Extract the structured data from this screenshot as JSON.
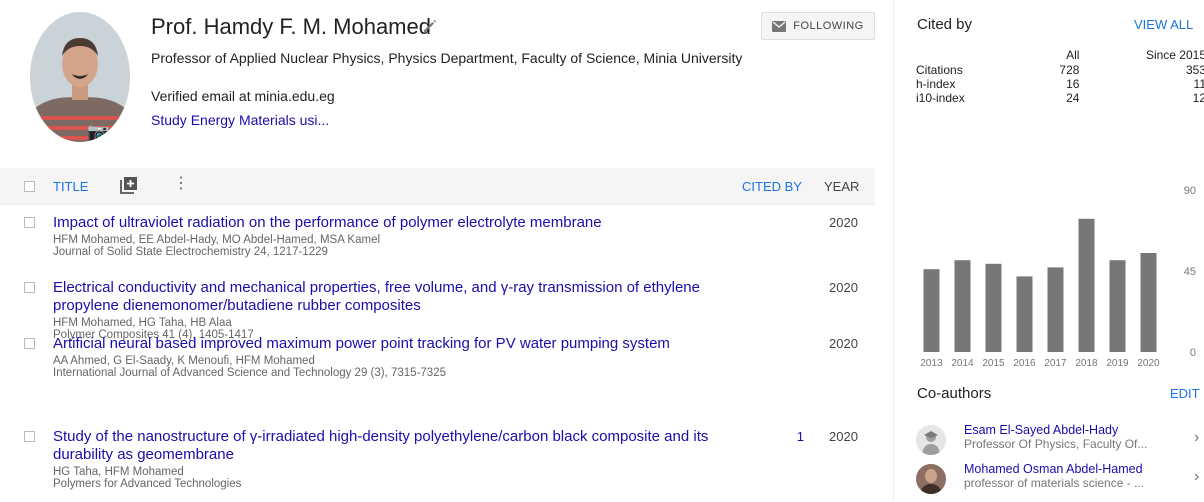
{
  "profile": {
    "name": "Prof. Hamdy F. M. Mohamed",
    "affiliation": "Professor of Applied Nuclear Physics, Physics Department, Faculty of Science, Minia University",
    "email": "Verified email at minia.edu.eg",
    "interest": "Study Energy Materials usi...",
    "follow_label": "FOLLOWING"
  },
  "table": {
    "title_header": "TITLE",
    "cited_by_header": "CITED BY",
    "year_header": "YEAR",
    "rows": [
      {
        "title": "Impact of ultraviolet radiation on the performance of polymer electrolyte membrane",
        "authors": "HFM Mohamed, EE Abdel-Hady, MO Abdel-Hamed, MSA Kamel",
        "venue": "Journal of Solid State Electrochemistry 24, 1217-1229",
        "cited": "",
        "year": "2020"
      },
      {
        "title": "Electrical conductivity and mechanical properties, free volume, and γ-ray transmission of ethylene propylene dienemonomer/butadiene rubber composites",
        "authors": "HFM Mohamed, HG Taha, HB Alaa",
        "venue": "Polymer Composites 41 (4), 1405-1417",
        "cited": "",
        "year": "2020"
      },
      {
        "title": "Artificial neural based improved maximum power point tracking for PV water pumping system",
        "authors": "AA Ahmed, G El-Saady, K Menoufi, HFM Mohamed",
        "venue": "International Journal of Advanced Science and Technology 29 (3), 7315-7325",
        "cited": "",
        "year": "2020"
      },
      {
        "title": "Study of the nanostructure of γ-irradiated high-density polyethylene/carbon black composite and its durability as geomembrane",
        "authors": "HG Taha, HFM Mohamed",
        "venue": "Polymers for Advanced Technologies",
        "cited": "1",
        "year": "2020"
      }
    ]
  },
  "cited_by": {
    "title": "Cited by",
    "view_all": "VIEW ALL",
    "col_all": "All",
    "col_since": "Since 2015",
    "metrics": [
      {
        "label": "Citations",
        "all": "728",
        "since": "353"
      },
      {
        "label": "h-index",
        "all": "16",
        "since": "11"
      },
      {
        "label": "i10-index",
        "all": "24",
        "since": "12"
      }
    ]
  },
  "chart_data": {
    "type": "bar",
    "categories": [
      "2013",
      "2014",
      "2015",
      "2016",
      "2017",
      "2018",
      "2019",
      "2020"
    ],
    "values": [
      46,
      51,
      49,
      42,
      47,
      74,
      51,
      55
    ],
    "ylim": [
      0,
      90
    ],
    "yticks": [
      "0",
      "45",
      "90"
    ],
    "bar_color": "#777777"
  },
  "coauthors": {
    "title": "Co-authors",
    "edit_label": "EDIT",
    "items": [
      {
        "name": "Esam El-Sayed Abdel-Hady",
        "affiliation": "Professor Of Physics, Faculty Of..."
      },
      {
        "name": "Mohamed Osman Abdel-Hamed",
        "affiliation": "professor of materials science - ..."
      }
    ]
  }
}
